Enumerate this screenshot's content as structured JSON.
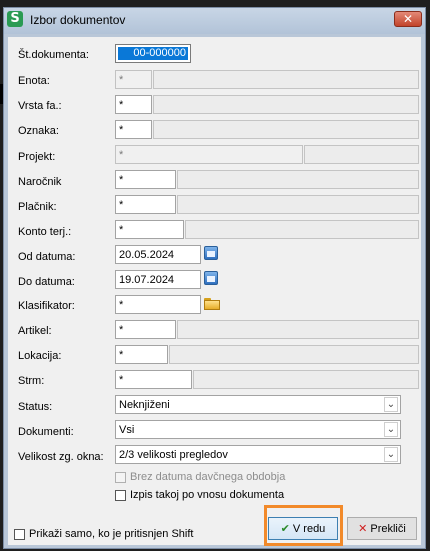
{
  "window": {
    "title": "Izbor dokumentov",
    "app_icon_letter": "S",
    "close_label": "✕"
  },
  "fields": {
    "st_dokumenta": {
      "label": "Št.dokumenta:",
      "value": "00-000000"
    },
    "enota": {
      "label": "Enota:",
      "value": "*"
    },
    "vrsta_fa": {
      "label": "Vrsta fa.:",
      "value": "*"
    },
    "oznaka": {
      "label": "Oznaka:",
      "value": "*"
    },
    "projekt": {
      "label": "Projekt:",
      "value": "*"
    },
    "narocnik": {
      "label": "Naročnik",
      "value": "*"
    },
    "placnik": {
      "label": "Plačnik:",
      "value": "*"
    },
    "konto_terj": {
      "label": "Konto terj.:",
      "value": "*"
    },
    "od_datuma": {
      "label": "Od datuma:",
      "value": "20.05.2024"
    },
    "do_datuma": {
      "label": "Do datuma:",
      "value": "19.07.2024"
    },
    "klasifikator": {
      "label": "Klasifikator:",
      "value": "*"
    },
    "artikel": {
      "label": "Artikel:",
      "value": "*"
    },
    "lokacija": {
      "label": "Lokacija:",
      "value": "*"
    },
    "strm": {
      "label": "Strm:",
      "value": "*"
    }
  },
  "selects": {
    "status": {
      "label": "Status:",
      "value": "Neknjiženi"
    },
    "dokumenti": {
      "label": "Dokumenti:",
      "value": "Vsi"
    },
    "velikost": {
      "label": "Velikost zg. okna:",
      "value": "2/3 velikosti pregledov"
    }
  },
  "checkboxes": {
    "brez_datuma": {
      "label": "Brez datuma davčnega obdobja",
      "checked": false,
      "disabled": true
    },
    "izpis_takoj": {
      "label": "Izpis takoj po vnosu dokumenta",
      "checked": false,
      "disabled": false
    },
    "prikazi_shift": {
      "label": "Prikaži samo, ko je pritisnjen Shift",
      "checked": false,
      "disabled": false
    }
  },
  "buttons": {
    "ok_label": "V redu",
    "cancel_label": "Prekliči"
  },
  "icons": {
    "ok": "checkmark-icon",
    "cancel": "x-icon",
    "calendar": "calendar-icon",
    "folder": "folder-icon"
  },
  "colors": {
    "highlight": "#f28a2a",
    "selection": "#0a78d7",
    "title_bg": "#b9c7d8"
  }
}
